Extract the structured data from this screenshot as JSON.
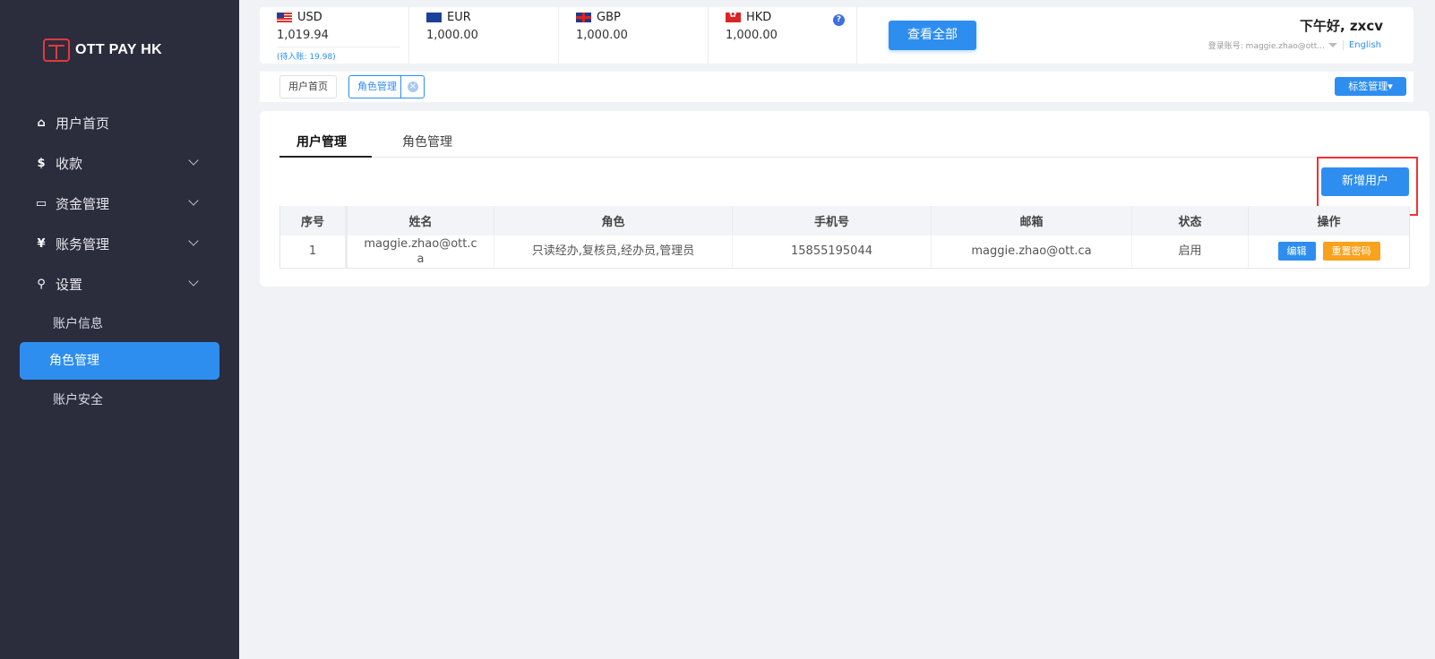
{
  "brand": {
    "name": "OTT PAY HK"
  },
  "sidebar": {
    "items": [
      {
        "label": "用户首页",
        "icon": "home-icon",
        "glyph": "⌂"
      },
      {
        "label": "收款",
        "icon": "dollar-icon",
        "glyph": "$"
      },
      {
        "label": "资金管理",
        "icon": "card-icon",
        "glyph": "▭"
      },
      {
        "label": "账务管理",
        "icon": "yen-icon",
        "glyph": "¥"
      },
      {
        "label": "设置",
        "icon": "search-icon",
        "glyph": "⚲"
      }
    ],
    "sub_items": [
      {
        "label": "账户信息"
      },
      {
        "label": "角色管理",
        "active": true
      },
      {
        "label": "账户安全"
      }
    ]
  },
  "currencies": [
    {
      "code": "USD",
      "amount": "1,019.94",
      "pending": "(待入账: 19.98)"
    },
    {
      "code": "EUR",
      "amount": "1,000.00"
    },
    {
      "code": "GBP",
      "amount": "1,000.00"
    },
    {
      "code": "HKD",
      "amount": "1,000.00"
    }
  ],
  "header": {
    "help_glyph": "?",
    "view_all_label": "查看全部",
    "greeting": "下午好,  zxcv",
    "login_label": "登录账号: maggie.zhao@ott...",
    "language": "English"
  },
  "tags": {
    "items": [
      {
        "label": "用户首页"
      },
      {
        "label": "角色管理"
      }
    ],
    "manager_label": "标签管理▾"
  },
  "main": {
    "tabs": [
      {
        "label": "用户管理",
        "active": true
      },
      {
        "label": "角色管理"
      }
    ],
    "add_user_label": "新增用户",
    "table": {
      "headers": [
        "序号",
        "姓名",
        "角色",
        "手机号",
        "邮箱",
        "状态",
        "操作"
      ],
      "rows": [
        {
          "index": "1",
          "name": "maggie.zhao@ott.ca",
          "roles": "只读经办,复核员,经办员,管理员",
          "phone": "15855195044",
          "email": "maggie.zhao@ott.ca",
          "status": "启用",
          "edit_label": "编辑",
          "reset_label": "重置密码"
        }
      ]
    }
  },
  "colors": {
    "accent": "#2e8ef0",
    "sidebar_bg": "#2b2d3d",
    "warning": "#f8a21d",
    "highlight": "#e33333"
  }
}
